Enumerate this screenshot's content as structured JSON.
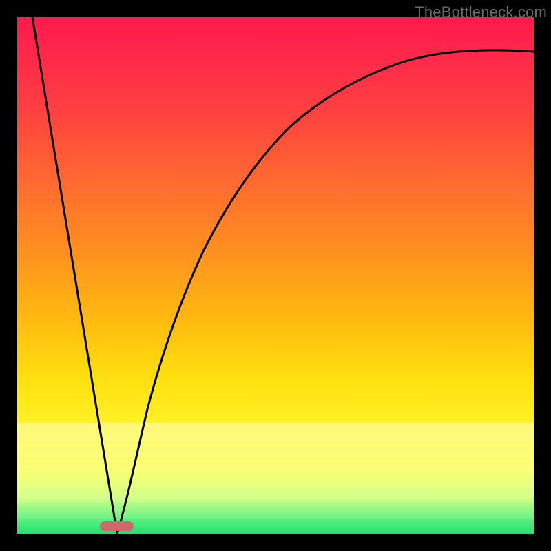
{
  "watermark": "TheBottleneck.com",
  "marker": {
    "left_pct": 16.0,
    "width_pct": 6.5,
    "bottom_pct": 0.6
  },
  "chart_data": {
    "type": "line",
    "title": "",
    "xlabel": "",
    "ylabel": "",
    "xlim": [
      0,
      100
    ],
    "ylim": [
      0,
      100
    ],
    "grid": false,
    "legend": false,
    "background": "rainbow-vertical-gradient (red top → green bottom)",
    "series": [
      {
        "name": "left-descending-segment",
        "x": [
          3.0,
          19.3
        ],
        "y": [
          100.0,
          0.0
        ]
      },
      {
        "name": "right-rising-curve",
        "x": [
          19.3,
          22,
          25,
          28,
          32,
          36,
          40,
          45,
          50,
          55,
          60,
          66,
          72,
          80,
          88,
          100
        ],
        "y": [
          0.0,
          12,
          23,
          32,
          42,
          50,
          57,
          64,
          70,
          74.5,
          78.5,
          82.5,
          85.5,
          88.5,
          90.7,
          93.3
        ]
      }
    ],
    "annotations": [
      {
        "name": "bottom-marker",
        "shape": "rounded-bar",
        "x_center_pct": 19.3,
        "y_pct": 0.6,
        "color": "#cf6a6a"
      }
    ]
  }
}
